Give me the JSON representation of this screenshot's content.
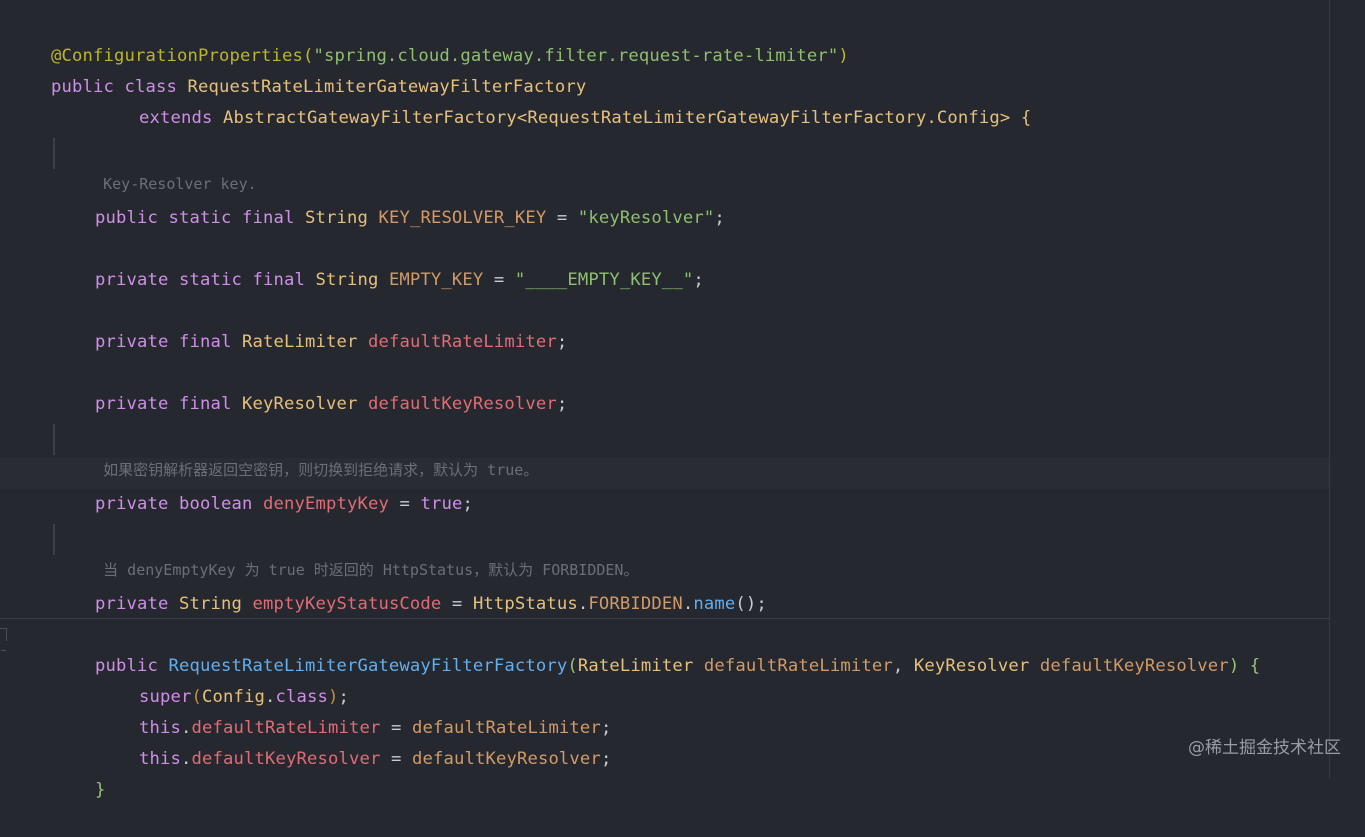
{
  "code": {
    "line1": {
      "ann": "@ConfigurationProperties(",
      "str": "\"spring.cloud.gateway.filter.request-rate-limiter\"",
      "close": ")"
    },
    "line2": {
      "kw": "public class ",
      "cls": "RequestRateLimiterGatewayFilterFactory"
    },
    "line3": {
      "kw": "extends ",
      "cls": "AbstractGatewayFilterFactory<RequestRateLimiterGatewayFilterFactory.Config>",
      "brace": " {"
    },
    "doc1": "Key-Resolver key.",
    "line5": {
      "kw": "public static final ",
      "type": "String ",
      "name": "KEY_RESOLVER_KEY",
      "eq": " = ",
      "str": "\"keyResolver\"",
      "semi": ";"
    },
    "line6": {
      "kw": "private static final ",
      "type": "String ",
      "name": "EMPTY_KEY",
      "eq": " = ",
      "str": "\"____EMPTY_KEY__\"",
      "semi": ";"
    },
    "line7": {
      "kw": "private final ",
      "type": "RateLimiter ",
      "name": "defaultRateLimiter",
      "semi": ";"
    },
    "line8": {
      "kw": "private final ",
      "type": "KeyResolver ",
      "name": "defaultKeyResolver",
      "semi": ";"
    },
    "doc2": {
      "cjk": "如果密钥解析器返回空密钥，则切换到拒绝请求，默认为",
      "code": " true",
      "end": "。"
    },
    "line10": {
      "kw": "private boolean ",
      "name": "denyEmptyKey",
      "eq": " = ",
      "val": "true",
      "semi": ";"
    },
    "doc3": {
      "a": "当",
      "b": " denyEmptyKey ",
      "c": "为",
      "d": " true ",
      "e": "时返回的",
      "f": " HttpStatus",
      "g": "，默认为",
      "h": " FORBIDDEN",
      "i": "。"
    },
    "line12": {
      "kw": "private ",
      "type": "String ",
      "name": "emptyKeyStatusCode",
      "eq": " = ",
      "cls": "HttpStatus",
      "dot": ".",
      "cst": "FORBIDDEN",
      "dot2": ".",
      "fn": "name",
      "paren": "()",
      "semi": ";"
    },
    "line13": {
      "kw": "public ",
      "fn": "RequestRateLimiterGatewayFilterFactory",
      "open": "(",
      "t1": "RateLimiter ",
      "p1": "defaultRateLimiter",
      "comma": ", ",
      "t2": "KeyResolver ",
      "p2": "defaultKeyResolver",
      "close": ")",
      "brace": " {"
    },
    "line14": {
      "kw": "super",
      "open": "(",
      "cls": "Config",
      "dot": ".",
      "kw2": "class",
      "close": ")",
      "semi": ";"
    },
    "line15": {
      "kw": "this",
      "dot": ".",
      "fld": "defaultRateLimiter",
      "eq": " = ",
      "prm": "defaultRateLimiter",
      "semi": ";"
    },
    "line16": {
      "kw": "this",
      "dot": ".",
      "fld": "defaultKeyResolver",
      "eq": " = ",
      "prm": "defaultKeyResolver",
      "semi": ";"
    },
    "line17": {
      "brace": "}"
    }
  },
  "watermark": "@稀土掘金技术社区",
  "colors": {
    "background": "#262830",
    "keyword": "#cf8ee8",
    "string": "#8fbf6e",
    "annotation": "#bbb529",
    "field": "#e06c75",
    "type": "#e6c07b",
    "function": "#61afef"
  }
}
